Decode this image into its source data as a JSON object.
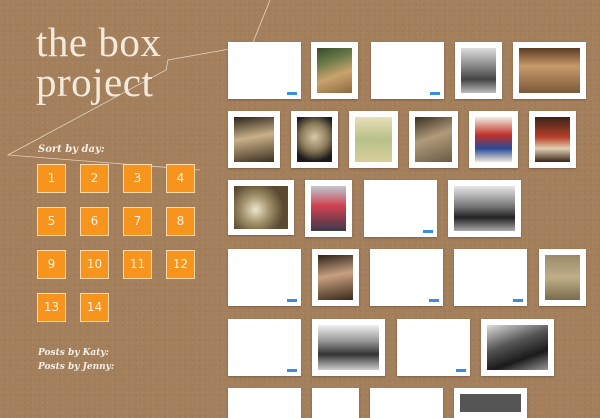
{
  "site": {
    "title_line1": "the box",
    "title_line2": "project"
  },
  "sidebar": {
    "sort_label": "Sort by day:",
    "days": [
      "1",
      "2",
      "3",
      "4",
      "5",
      "6",
      "7",
      "8",
      "9",
      "10",
      "11",
      "12",
      "13",
      "14"
    ],
    "posts_katy": "Posts by Katy:",
    "posts_jenny": "Posts by Jenny:"
  },
  "colors": {
    "background": "#a37f5c",
    "accent": "#f7941d",
    "title": "#f4eadc"
  },
  "photos": [
    {
      "kind": "placeholder"
    },
    {
      "kind": "photo",
      "subject": "cardboard box on table"
    },
    {
      "kind": "placeholder"
    },
    {
      "kind": "photo",
      "subject": "black and white group photo"
    },
    {
      "kind": "photo",
      "subject": "DEC 2 dated box"
    },
    {
      "kind": "photo",
      "subject": "old paper"
    },
    {
      "kind": "photo",
      "subject": "crumpled newspaper"
    },
    {
      "kind": "photo",
      "subject": "vintage booklet"
    },
    {
      "kind": "photo",
      "subject": "stack of papers"
    },
    {
      "kind": "photo",
      "subject": "red and blue poster"
    },
    {
      "kind": "photo",
      "subject": "red printed card"
    },
    {
      "kind": "photo",
      "subject": "glass ornament"
    },
    {
      "kind": "photo",
      "subject": "old postcard"
    },
    {
      "kind": "placeholder"
    },
    {
      "kind": "photo",
      "subject": "black and white group photo"
    },
    {
      "kind": "placeholder"
    },
    {
      "kind": "photo",
      "subject": "letters"
    },
    {
      "kind": "placeholder"
    },
    {
      "kind": "placeholder"
    },
    {
      "kind": "photo",
      "subject": "worn notebook"
    },
    {
      "kind": "placeholder"
    },
    {
      "kind": "photo",
      "subject": "black and white outdoor photo"
    },
    {
      "kind": "placeholder"
    },
    {
      "kind": "photo",
      "subject": "black and white portrait"
    }
  ]
}
